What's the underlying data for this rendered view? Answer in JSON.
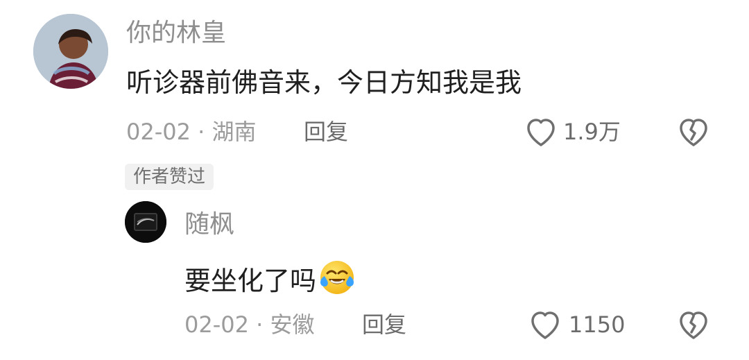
{
  "comments": [
    {
      "username": "你的林皇",
      "text": "听诊器前佛音来，今日方知我是我",
      "date_location": "02-02 · 湖南",
      "reply_label": "回复",
      "likes": "1.9万",
      "badge": "作者赞过",
      "avatar_icon": "profile-avatar",
      "like_icon": "heart-outline-icon",
      "dislike_icon": "broken-heart-icon"
    },
    {
      "username": "随枫",
      "text": "要坐化了吗",
      "emoji_icon": "laughing-crying-emoji",
      "date_location": "02-02 · 安徽",
      "reply_label": "回复",
      "likes": "1150",
      "avatar_icon": "profile-avatar",
      "like_icon": "heart-outline-icon",
      "dislike_icon": "broken-heart-icon"
    }
  ],
  "colors": {
    "username": "#8e8e8e",
    "content": "#1f1f1f",
    "meta": "#9b9b9b",
    "badge_bg": "#f1f1f1"
  }
}
